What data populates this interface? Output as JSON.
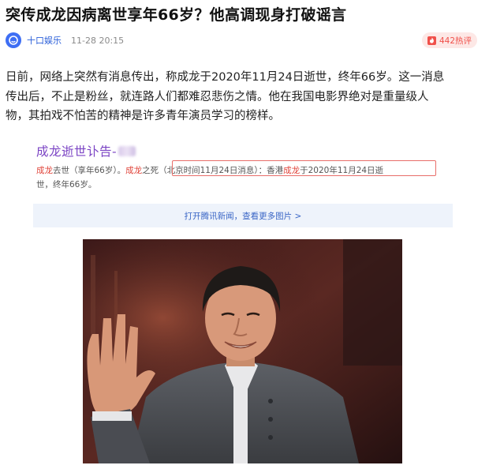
{
  "headline": "突传成龙因病离世享年66岁？他高调现身打破谣言",
  "meta": {
    "source": "十口娱乐",
    "time": "11-28 20:15",
    "hot": "442热评",
    "avatar_icon": "face-icon",
    "hot_icon": "fire-icon"
  },
  "paragraph": {
    "line1": "日前，网络上突然有消息传出，称成龙于2020年11月24日逝世，终年66岁。这一消息",
    "line2": "传出后，不止是粉丝，就连路人们都难忍悲伤之情。他在我国电影界绝对是重量级人",
    "line3": "物，其拍戏不怕苦的精神是许多青年演员学习的榜样。"
  },
  "screenshot": {
    "title": "成龙逝世讣告-",
    "line1_a": "成龙",
    "line1_b": "去世（享年66岁）。",
    "line1_c": "成龙",
    "line1_d": "之死（北京时间11月24日消息）：香港",
    "line1_e": "成龙",
    "line1_f": "于2020年11月24日逝",
    "line2": "世，终年66岁。",
    "link": "打开腾讯新闻，查看更多图片 >"
  },
  "colors": {
    "accent_blue": "#2b5fd9",
    "hot_red": "#f0504a",
    "title_purple": "#7b44c4",
    "highlight_red": "#e0463c"
  }
}
